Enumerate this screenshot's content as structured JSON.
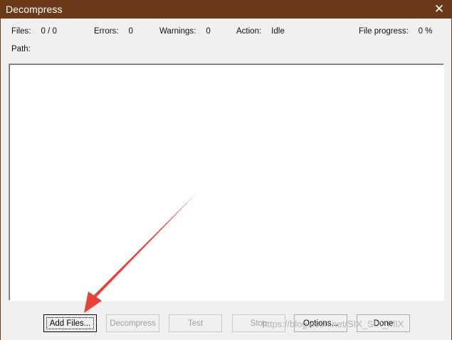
{
  "window": {
    "title": "Decompress",
    "close_glyph": "✕"
  },
  "info": {
    "files_label": "Files:",
    "files_value": "0 / 0",
    "errors_label": "Errors:",
    "errors_value": "0",
    "warnings_label": "Warnings:",
    "warnings_value": "0",
    "action_label": "Action:",
    "action_value": "Idle",
    "file_progress_label": "File progress:",
    "file_progress_value": "0 %",
    "path_label": "Path:"
  },
  "buttons": {
    "add_files": {
      "label": "Add Files...",
      "enabled": true
    },
    "decompress": {
      "label": "Decompress",
      "enabled": false
    },
    "test": {
      "label": "Test",
      "enabled": false
    },
    "stop": {
      "label": "Stop",
      "enabled": false
    },
    "options": {
      "label": "Options...",
      "enabled": true
    },
    "done": {
      "label": "Done",
      "enabled": true
    }
  },
  "annotation": {
    "arrow_color": "#e8413a"
  },
  "watermark": "https://blog.csdn.net/SIX_SIX_MIX",
  "colors": {
    "titlebar": "#6b3a1a",
    "dialog_bg": "#f0f0f0"
  }
}
